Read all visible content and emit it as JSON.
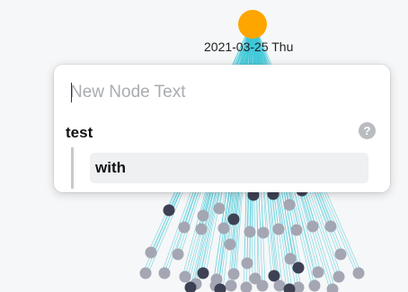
{
  "graph": {
    "root_color": "#ffa500",
    "edge_color": "#3cc8d8",
    "node_light": "#a4a6b3",
    "node_dark": "#3e4154",
    "date_label": "2021-03-25 Thu"
  },
  "editor": {
    "input_value": "",
    "input_placeholder": "New Node Text",
    "parent_label": "test",
    "help_icon_glyph": "?",
    "child_items": [
      "with"
    ]
  }
}
